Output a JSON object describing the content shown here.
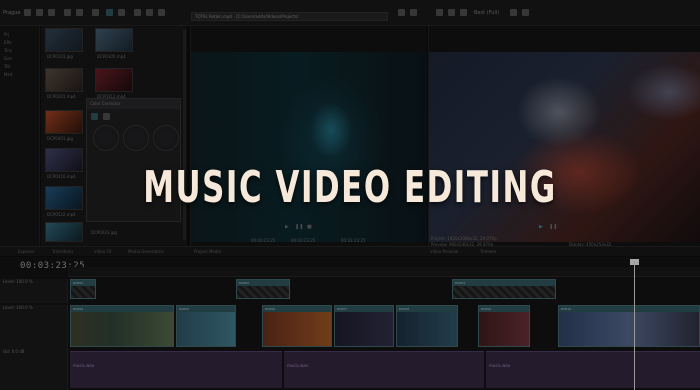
{
  "toolbar": {
    "project_label": "Prague",
    "title_field": "TOTAL Retain.mp4  -  [C:/Users/edits/Videos/Projects/",
    "zoom_label": "Best (Full)"
  },
  "left_panel": {
    "items": [
      "Prj",
      "Effe",
      "Trns",
      "Gen",
      "Titl",
      "Med"
    ]
  },
  "media_bin": {
    "thumbs": [
      {
        "label": "DCP0101.jpg"
      },
      {
        "label": "DCP0105.mp4"
      },
      {
        "label": "DCP0201.mp4"
      },
      {
        "label": "DCP0312.mp4"
      },
      {
        "label": "DCP0401.jpg"
      },
      {
        "label": "DCP0416.mp4"
      },
      {
        "label": "DCP0522.mp4"
      },
      {
        "label": "DCP0633.jpg"
      }
    ]
  },
  "float_panel": {
    "title": "Color Corrector"
  },
  "preview_left": {
    "caption_a": "00:03:23:25",
    "caption_b": "00:03:23:25",
    "caption_c": "00:03:23:25"
  },
  "preview_right": {
    "caption_a": "Project: 1920x1080x32, 29.970p",
    "caption_b": "Preview: 960x540x32, 29.970p",
    "caption_c": "Display: 450x253x32"
  },
  "headline": "MUSIC VIDEO EDITING",
  "tabs": [
    "Explorer",
    "Transitions",
    "Video FX",
    "Media Generators",
    "Project Media",
    "Video Preview",
    "Trimmer"
  ],
  "timeline": {
    "timecode": "00:03:23:25",
    "tracks": [
      "Level: 100.0 %",
      "Level: 100.0 %",
      "Vol: 0.0 dB"
    ],
    "clip_names": [
      "DCP01",
      "DCP02",
      "DCP03",
      "DCP04",
      "DCP05",
      "DCP06",
      "DCP07",
      "DCP08",
      "DCP09",
      "DCP10"
    ],
    "audio_names": [
      "music.wav",
      "music.wav",
      "music.wav"
    ]
  },
  "colors": {
    "accent": "#2a4b50",
    "headline": "#f6e9da",
    "audio": "#2c2238"
  }
}
